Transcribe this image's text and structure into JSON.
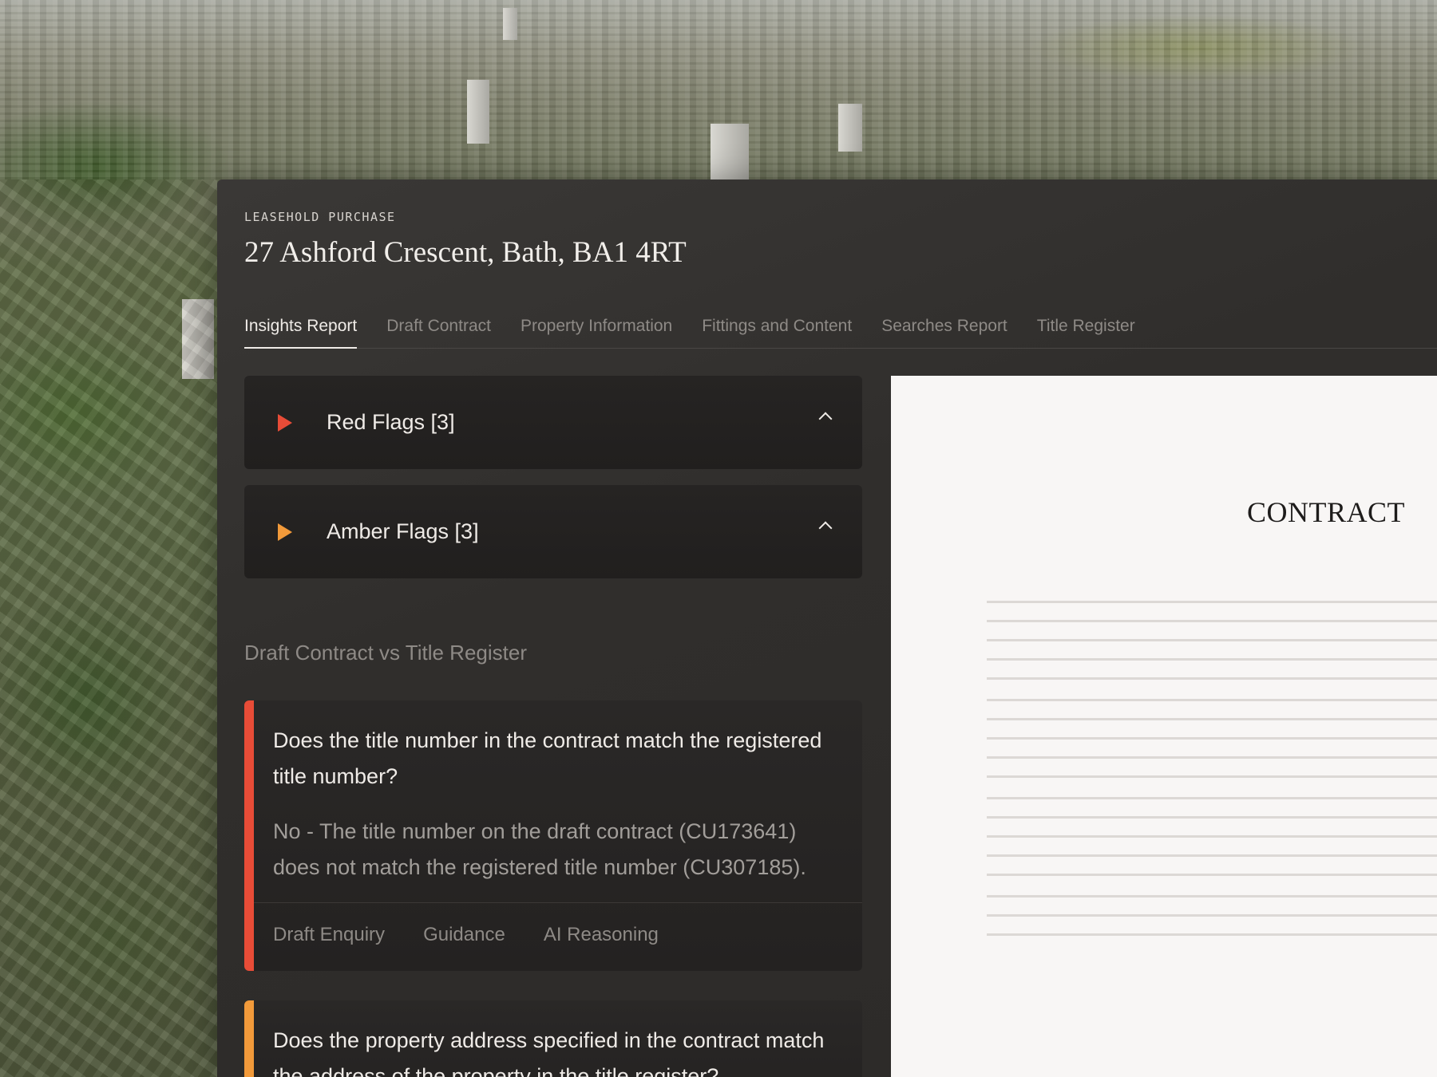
{
  "matter": {
    "type": "LEASEHOLD  PURCHASE",
    "address": "27 Ashford Crescent, Bath, BA1 4RT"
  },
  "tabs": [
    {
      "label": "Insights Report",
      "active": true
    },
    {
      "label": "Draft Contract",
      "active": false
    },
    {
      "label": "Property Information",
      "active": false
    },
    {
      "label": "Fittings and Content",
      "active": false
    },
    {
      "label": "Searches Report",
      "active": false
    },
    {
      "label": "Title Register",
      "active": false
    }
  ],
  "flags": {
    "red": {
      "label": "Red Flags  [3]",
      "color": "#e84c37"
    },
    "amber": {
      "label": "Amber Flags  [3]",
      "color": "#f29a3a"
    }
  },
  "section": {
    "title": "Draft Contract vs Title Register"
  },
  "questions": [
    {
      "severity": "red",
      "question": "Does the title number in the contract match the registered title number?",
      "answer": "No - The title number on the draft contract (CU173641) does not match the registered title number (CU307185).",
      "actions": [
        "Draft Enquiry",
        "Guidance",
        "AI Reasoning"
      ]
    },
    {
      "severity": "amber",
      "question": "Does the property address specified in the contract match the address of the property in the title register?"
    }
  ],
  "document": {
    "heading": "CONTRACT"
  }
}
